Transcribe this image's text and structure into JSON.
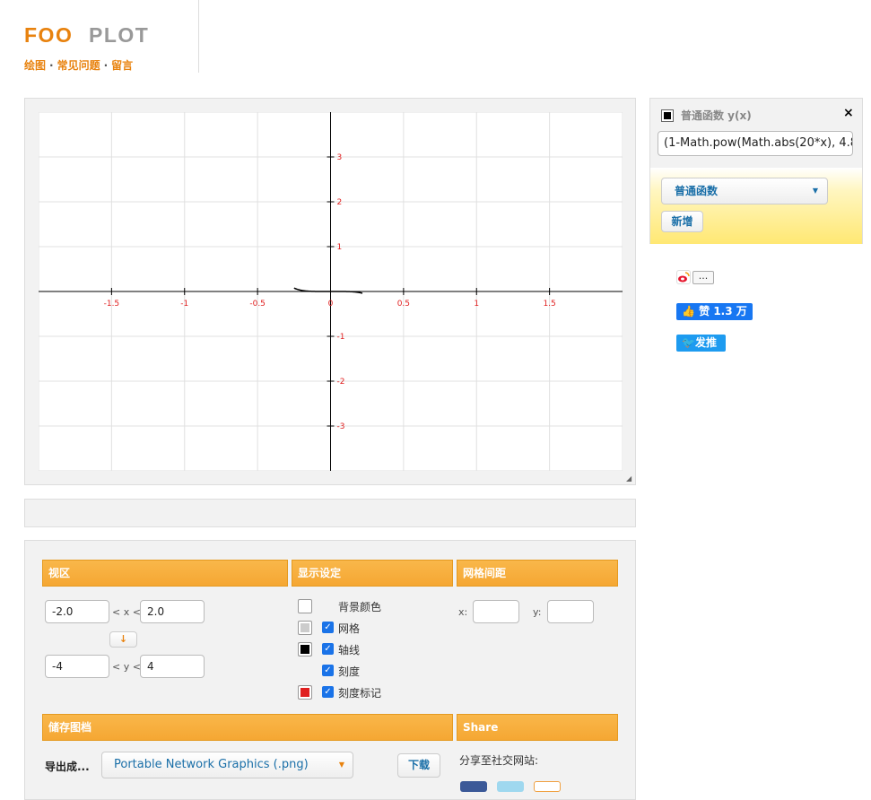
{
  "header": {
    "logo_text": "FOOPLOT",
    "nav": [
      {
        "label": "绘图"
      },
      {
        "label": "常见问题"
      },
      {
        "label": "留言"
      }
    ],
    "nav_separator": "·"
  },
  "plot": {
    "x_ticks": [
      "-1.5",
      "-1",
      "-0.5",
      "0",
      "0.5",
      "1",
      "1.5"
    ],
    "y_ticks": [
      "3",
      "2",
      "1",
      "-1",
      "-2",
      "-3"
    ],
    "resize_glyph": "◢",
    "axis_color": "#000000",
    "grid_color": "#e0e0e0",
    "tick_label_color": "#e02020",
    "x_range": [
      -2.0,
      2.0
    ],
    "y_range": [
      -4,
      4
    ]
  },
  "function_panel": {
    "title": "普通函数 y(x)",
    "close": "×",
    "expression": "(1-Math.pow(Math.abs(20*x), 4.8",
    "type_select": "普通函数",
    "add_button": "新增"
  },
  "social": {
    "more": "...",
    "like": "赞 1.3 万",
    "tweet": "发推"
  },
  "settings": {
    "viewport": {
      "title": "视区",
      "xmin": "-2.0",
      "xmax": "2.0",
      "x_label": "< x <",
      "ymin": "-4",
      "ymax": "4",
      "y_label": "< y <",
      "swap": "↓"
    },
    "display": {
      "title": "显示设定",
      "items": [
        {
          "label": "背景颜色",
          "checked": false,
          "color": "#ffffff"
        },
        {
          "label": "网格",
          "checked": true,
          "color": "#cccccc"
        },
        {
          "label": "轴线",
          "checked": true,
          "color": "#000000"
        },
        {
          "label": "刻度",
          "checked": true,
          "color": ""
        },
        {
          "label": "刻度标记",
          "checked": true,
          "color": "#e02020"
        }
      ]
    },
    "grid_spacing": {
      "title": "网格间距",
      "x_label": "x:",
      "y_label": "y:",
      "x_value": "",
      "y_value": ""
    },
    "save": {
      "title": "储存图档",
      "export_label": "导出成...",
      "format": "Portable Network Graphics (.png)",
      "download": "下载"
    },
    "share": {
      "title": "Share",
      "label": "分享至社交网站:"
    }
  },
  "colors": {
    "accent_orange": "#f5a733",
    "link_orange": "#e8820e",
    "link_blue": "#1a6fa8"
  }
}
